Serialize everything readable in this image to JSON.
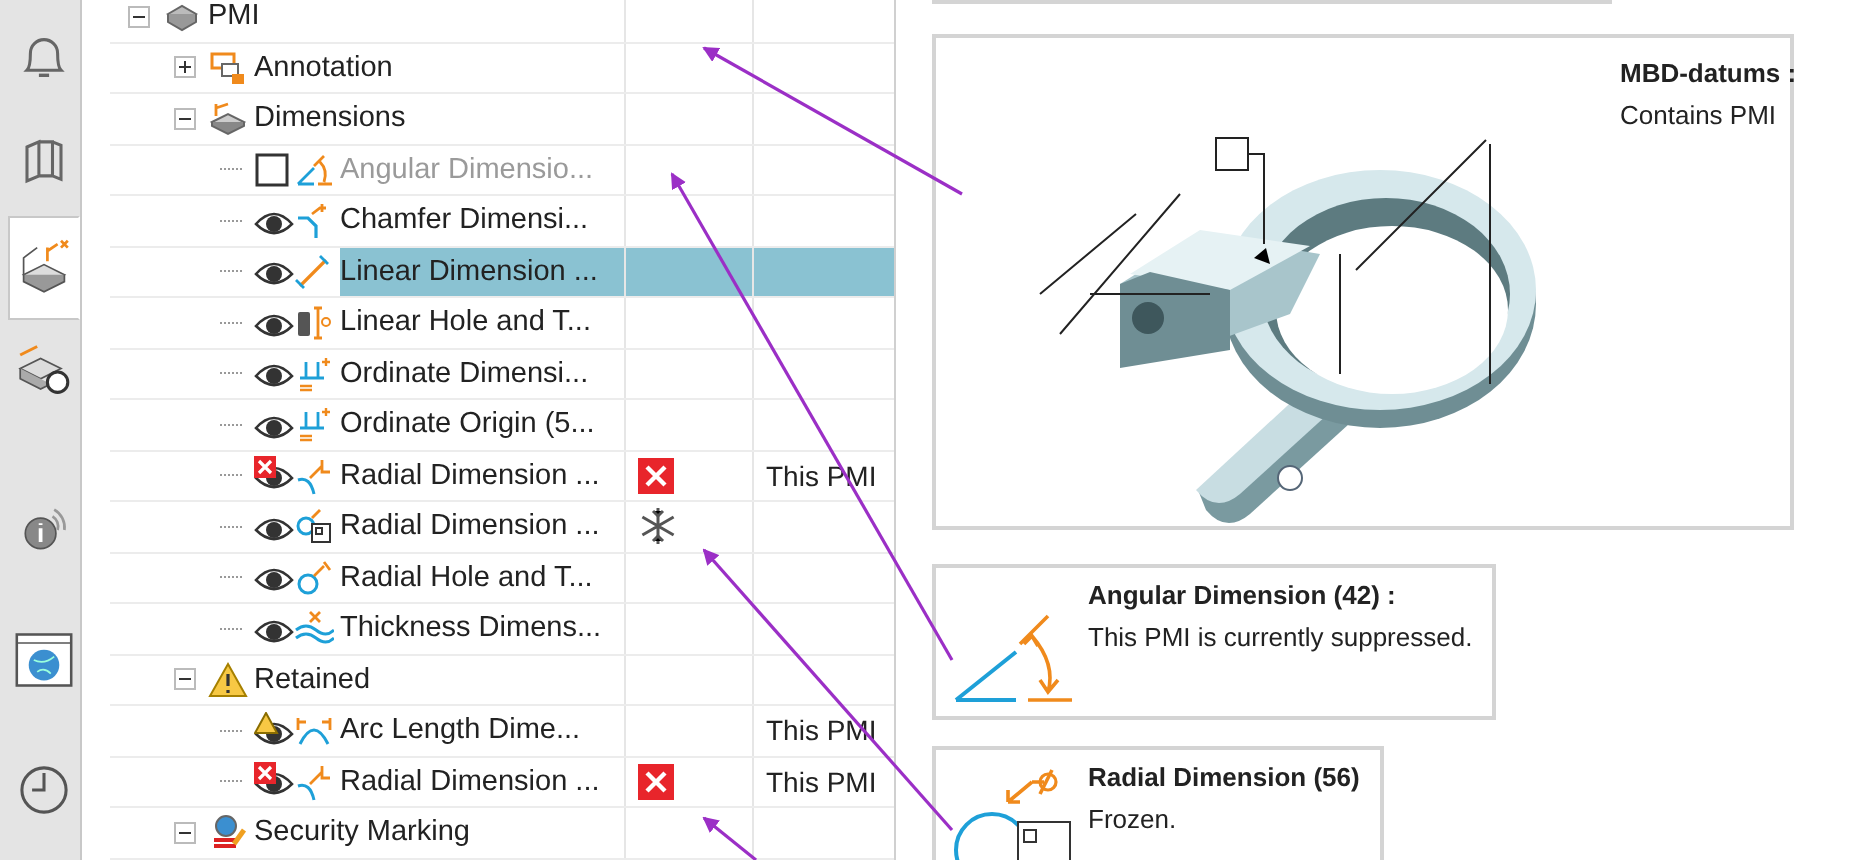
{
  "sidebar": {
    "top_tabs": [
      {
        "kind": "bell",
        "selected": false
      },
      {
        "kind": "books",
        "selected": false
      },
      {
        "kind": "pmi",
        "selected": true
      },
      {
        "kind": "inspect",
        "selected": false
      }
    ],
    "bottom_tabs": [
      {
        "kind": "info",
        "selected": false
      },
      {
        "kind": "globe",
        "selected": false
      },
      {
        "kind": "clock",
        "selected": false
      }
    ]
  },
  "tree": {
    "items": [
      {
        "label": "PMI",
        "kind": "pmi",
        "expanded": true,
        "children": [
          {
            "label": "Annotation",
            "kind": "annotation",
            "expanded": false
          },
          {
            "label": "Dimensions",
            "kind": "dimensions",
            "expanded": true,
            "children": [
              {
                "label": "Angular Dimensio...",
                "kind": "angular",
                "visible": false,
                "suppressed": true,
                "selected": false,
                "error": false,
                "warning": false,
                "frozen": false
              },
              {
                "label": "Chamfer Dimensi...",
                "kind": "chamfer",
                "visible": true,
                "suppressed": false,
                "selected": false,
                "error": false,
                "warning": false,
                "frozen": false
              },
              {
                "label": "Linear Dimension ...",
                "kind": "linear",
                "visible": true,
                "suppressed": false,
                "selected": true,
                "error": false,
                "warning": false,
                "frozen": false
              },
              {
                "label": "Linear Hole and T...",
                "kind": "hole",
                "visible": true,
                "suppressed": false,
                "selected": false,
                "error": false,
                "warning": false,
                "frozen": false
              },
              {
                "label": "Ordinate Dimensi...",
                "kind": "ordinate",
                "visible": true,
                "suppressed": false,
                "selected": false,
                "error": false,
                "warning": false,
                "frozen": false
              },
              {
                "label": "Ordinate Origin (5...",
                "kind": "ordinate",
                "visible": true,
                "suppressed": false,
                "selected": false,
                "error": false,
                "warning": false,
                "frozen": false
              },
              {
                "label": "Radial Dimension ...",
                "kind": "radial",
                "visible": true,
                "suppressed": false,
                "selected": false,
                "error": true,
                "warning": false,
                "frozen": false,
                "note": "This PMI"
              },
              {
                "label": "Radial Dimension ...",
                "kind": "radial-note",
                "visible": true,
                "suppressed": false,
                "selected": false,
                "error": false,
                "warning": false,
                "frozen": true
              },
              {
                "label": "Radial Hole and T...",
                "kind": "radial-hole",
                "visible": true,
                "suppressed": false,
                "selected": false,
                "error": false,
                "warning": false,
                "frozen": false
              },
              {
                "label": "Thickness Dimens...",
                "kind": "thickness",
                "visible": true,
                "suppressed": false,
                "selected": false,
                "error": false,
                "warning": false,
                "frozen": false
              }
            ]
          },
          {
            "label": "Retained",
            "kind": "warning",
            "expanded": true,
            "children": [
              {
                "label": "Arc Length Dime...",
                "kind": "arc",
                "visible": true,
                "suppressed": false,
                "selected": false,
                "error": false,
                "warning": true,
                "frozen": false,
                "note": "This PMI"
              },
              {
                "label": "Radial Dimension ...",
                "kind": "radial",
                "visible": true,
                "suppressed": false,
                "selected": false,
                "error": true,
                "warning": false,
                "frozen": false,
                "note": "This PMI"
              }
            ]
          },
          {
            "label": "Security Marking",
            "kind": "security",
            "expanded": true
          }
        ]
      }
    ]
  },
  "callouts": [
    {
      "kind": "cut"
    },
    {
      "kind": "preview",
      "title": "MBD-datums :",
      "text": "Contains PMI"
    },
    {
      "kind": "angular",
      "title": "Angular Dimension (42) :",
      "text": "This PMI is currently suppressed."
    },
    {
      "kind": "radial",
      "title": "Radial Dimension (56)",
      "text": "Frozen."
    }
  ]
}
